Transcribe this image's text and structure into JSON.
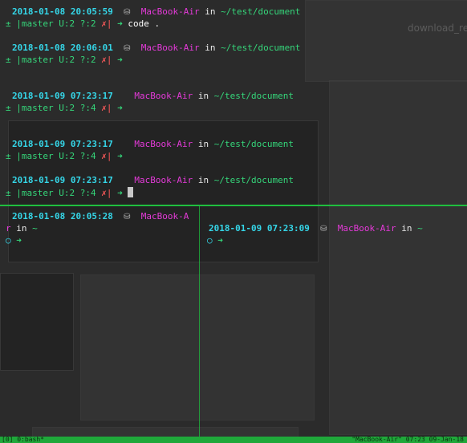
{
  "top_pane": {
    "blocks": [
      {
        "timestamp": "2018-01-08 20:05:59",
        "host": "MacBook-Air",
        "in": "in",
        "path": "~/test/document",
        "git_prefix": "± |master U:2 ?:2",
        "cross": "✗|",
        "arrow": "➜",
        "command": "code ."
      },
      {
        "timestamp": "2018-01-08 20:06:01",
        "host": "MacBook-Air",
        "in": "in",
        "path": "~/test/document",
        "git_prefix": "± |master U:2 ?:2",
        "cross": "✗|",
        "arrow": "➜",
        "command": ""
      },
      {
        "timestamp": "2018-01-09 07:23:17",
        "host": "MacBook-Air",
        "in": "in",
        "path": "~/test/document",
        "git_prefix": "± |master U:2 ?:4",
        "cross": "✗|",
        "arrow": "➜",
        "command": ""
      },
      {
        "timestamp": "2018-01-09 07:23:17",
        "host": "MacBook-Air",
        "in": "in",
        "path": "~/test/document",
        "git_prefix": "± |master U:2 ?:4",
        "cross": "✗|",
        "arrow": "➜",
        "command": ""
      },
      {
        "timestamp": "2018-01-09 07:23:17",
        "host": "MacBook-Air",
        "in": "in",
        "path": "~/test/document",
        "git_prefix": "± |master U:2 ?:4",
        "cross": "✗|",
        "arrow": "➜",
        "command": ""
      }
    ]
  },
  "left_pane": {
    "timestamp": "2018-01-08 20:05:28",
    "host": "MacBook-A",
    "wrap_rest": "r",
    "in": "in",
    "path": "~",
    "ring": "○",
    "arrow": "➜"
  },
  "right_pane": {
    "timestamp": "2018-01-09 07:23:09",
    "host": "MacBook-Air",
    "in": "in",
    "path": "~",
    "ring": "○",
    "arrow": "➜"
  },
  "background": {
    "ghost_label": "download_re"
  },
  "status_bar": {
    "left": "[0] 0:bash*",
    "right": "\"MacBook-Air\" 07:23 09-Jan-18"
  },
  "colors": {
    "timestamp": "#35d6e8",
    "host": "#e53ad9",
    "path": "#35d67a",
    "error_cross": "#ff5a5a",
    "pane_separator": "#1fbf3f"
  }
}
